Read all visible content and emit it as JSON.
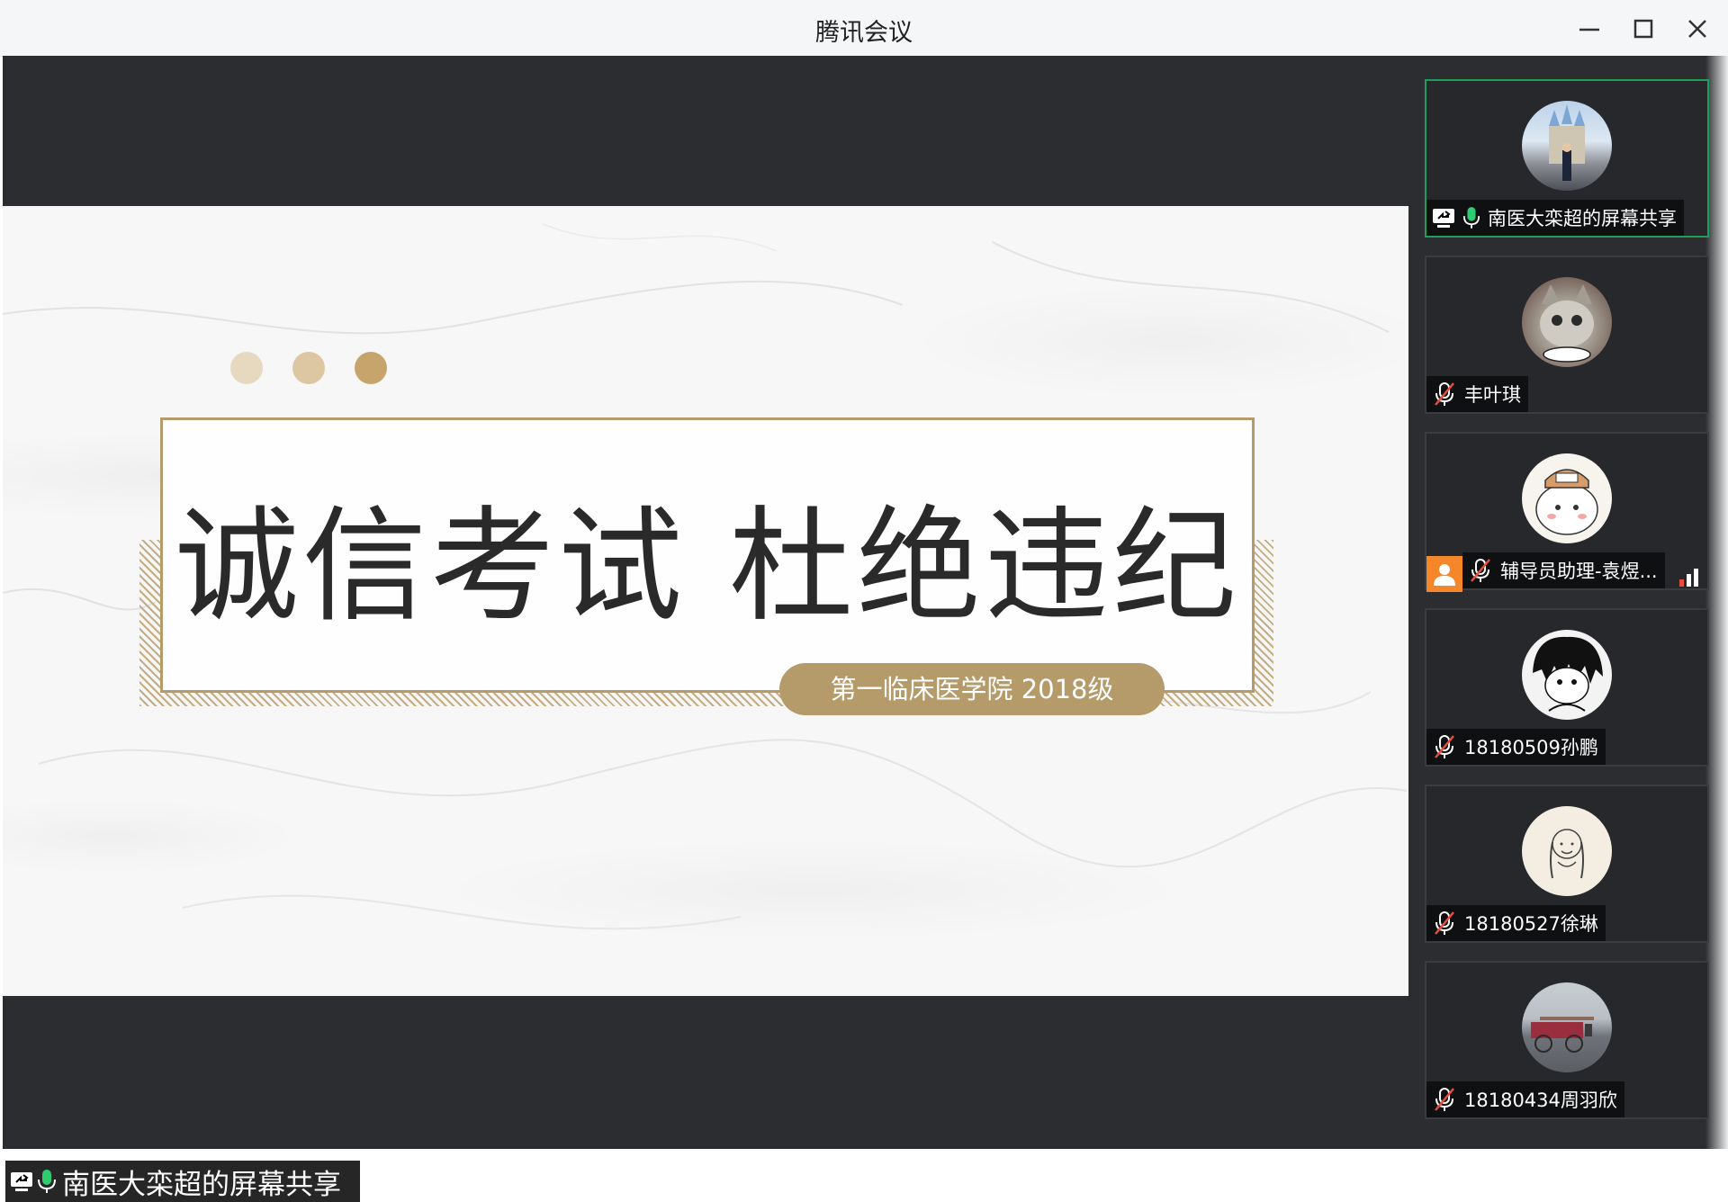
{
  "window": {
    "title": "腾讯会议"
  },
  "slide": {
    "title": "诚信考试 杜绝违纪",
    "subtitle": "第一临床医学院 2018级",
    "colors": {
      "gold": "#b59a6a",
      "dot1": "#e6d8bf",
      "dot2": "#d9c39d",
      "dot3": "#c6a46c"
    }
  },
  "sharer": {
    "label": "南医大栾超的屏幕共享"
  },
  "participants": [
    {
      "name": "南医大栾超的屏幕共享",
      "mic": "on",
      "screen_share_icon": true,
      "active": true,
      "avatar": "castle-photo"
    },
    {
      "name": "丰叶琪",
      "mic": "muted",
      "avatar": "cat-photo"
    },
    {
      "name": "辅导员助理-袁煜...",
      "mic": "muted",
      "user_badge": true,
      "signal_icon": true,
      "avatar": "cartoon-bear"
    },
    {
      "name": "18180509孙鹏",
      "mic": "muted",
      "avatar": "anime-boy"
    },
    {
      "name": "18180527徐琳",
      "mic": "muted",
      "avatar": "braids-girl-drawing"
    },
    {
      "name": "18180434周羽欣",
      "mic": "muted",
      "avatar": "street-photo"
    }
  ]
}
